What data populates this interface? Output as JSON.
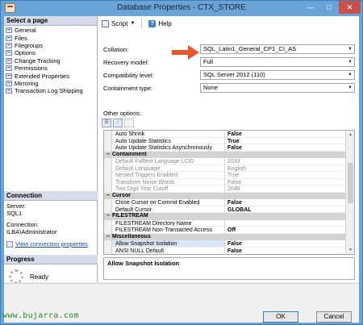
{
  "window": {
    "title": "Database Properties - CTX_STORE"
  },
  "left": {
    "select_page_header": "Select a page",
    "pages": [
      "General",
      "Files",
      "Filegroups",
      "Options",
      "Change Tracking",
      "Permissions",
      "Extended Properties",
      "Mirroring",
      "Transaction Log Shipping"
    ],
    "connection_header": "Connection",
    "server_label": "Server:",
    "server_value": "SQL1",
    "connection_label": "Connection:",
    "connection_value": "ILBA\\Administrator",
    "view_connection_link": "View connection properties",
    "progress_header": "Progress",
    "progress_status": "Ready"
  },
  "toolbar": {
    "script_label": "Script",
    "help_label": "Help"
  },
  "props": {
    "collation_label": "Collation:",
    "collation_value": "SQL_Latin1_General_CP1_CI_AS",
    "recovery_label": "Recovery model:",
    "recovery_value": "Full",
    "compat_label": "Compatibility level:",
    "compat_value": "SQL Server 2012 (110)",
    "containment_label": "Containment type:",
    "containment_value": "None",
    "other_options_label": "Other options:"
  },
  "grid": {
    "rows": [
      {
        "kind": "row",
        "name": "Auto Shrink",
        "value": "False"
      },
      {
        "kind": "row",
        "name": "Auto Update Statistics",
        "value": "True"
      },
      {
        "kind": "row",
        "name": "Auto Update Statistics Asynchronously",
        "value": "False"
      },
      {
        "kind": "cat",
        "name": "Containment"
      },
      {
        "kind": "row",
        "name": "Default Fulltext Language LCID",
        "value": "1033",
        "disabled": true
      },
      {
        "kind": "row",
        "name": "Default Language",
        "value": "English",
        "disabled": true
      },
      {
        "kind": "row",
        "name": "Nested Triggers Enabled",
        "value": "True",
        "disabled": true
      },
      {
        "kind": "row",
        "name": "Transform Noise Words",
        "value": "False",
        "disabled": true
      },
      {
        "kind": "row",
        "name": "Two Digit Year Cutoff",
        "value": "2049",
        "disabled": true
      },
      {
        "kind": "cat",
        "name": "Cursor"
      },
      {
        "kind": "row",
        "name": "Close Cursor on Commit Enabled",
        "value": "False"
      },
      {
        "kind": "row",
        "name": "Default Cursor",
        "value": "GLOBAL"
      },
      {
        "kind": "cat",
        "name": "FILESTREAM"
      },
      {
        "kind": "row",
        "name": "FILESTREAM Directory Name",
        "value": ""
      },
      {
        "kind": "row",
        "name": "FILESTREAM Non-Transacted Access",
        "value": "Off"
      },
      {
        "kind": "cat",
        "name": "Miscellaneous"
      },
      {
        "kind": "row",
        "name": "Allow Snapshot Isolation",
        "value": "False",
        "selected": true
      },
      {
        "kind": "row",
        "name": "ANSI NULL Default",
        "value": "False"
      }
    ]
  },
  "description": "Allow Snapshot Isolation",
  "buttons": {
    "ok": "OK",
    "cancel": "Cancel"
  },
  "watermark": "www.bujarra.com",
  "colors": {
    "titlebar": "#6aa3d8",
    "arrow": "#e8582e"
  }
}
